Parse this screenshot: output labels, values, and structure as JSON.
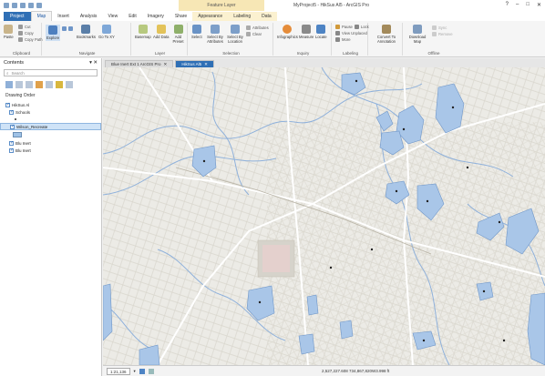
{
  "window": {
    "title": "MyProject5 - HikSus Al5 - ArcGIS Pro",
    "context_title": "Feature Layer"
  },
  "tabs": [
    "Project",
    "Map",
    "Insert",
    "Analysis",
    "View",
    "Edit",
    "Imagery",
    "Share",
    "Appearance",
    "Labeling",
    "Data"
  ],
  "ribbon": {
    "clipboard": {
      "paste": "Paste",
      "cut": "Cut",
      "copy": "Copy",
      "copy_path": "Copy Path",
      "label": "Clipboard"
    },
    "navigate": {
      "explore": "Explore",
      "bookmarks": "Bookmarks",
      "goto": "Go To XY",
      "label": "Navigate"
    },
    "layer": {
      "basemap": "Basemap",
      "add_data": "Add Data",
      "add_preset": "Add Preset",
      "label": "Layer"
    },
    "selection": {
      "select": "Select",
      "by_attributes": "Select By Attributes",
      "by_location": "Select By Location",
      "attributes": "Attributes",
      "clear": "Clear",
      "label": "Selection"
    },
    "inquiry": {
      "infographics": "Infographics",
      "measure": "Measure",
      "locate": "Locate",
      "label": "Inquiry"
    },
    "labeling": {
      "pause": "Pause",
      "lock": "Lock",
      "view_unplaced": "View Unplaced",
      "more": "More",
      "label": "Labeling"
    },
    "convert": {
      "convert": "Convert To Annotation"
    },
    "offline": {
      "download": "Download Map",
      "sync": "Sync",
      "remove": "Remove",
      "label": "Offline"
    }
  },
  "contents": {
    "title": "Contents",
    "search_placeholder": "Search",
    "drawing_order": "Drawing Order",
    "map_name": "HikSus Al",
    "layer_schools": "Schools",
    "layer_wilson": "Wilson_Recreate",
    "layer_blue1": "Blu Inert",
    "layer_blue2": "Blu Inert"
  },
  "map_tabs": [
    "Blue Inert Ext 1 ArcGIS Pro",
    "HikSus Al5"
  ],
  "status": {
    "scale": "1:21,136",
    "coords": "2,527,227.608 734,867,820W3.998 ft"
  },
  "colors": {
    "water": "#a9c6e8",
    "water_stroke": "#6f96c8",
    "road": "#ffffff",
    "road_minor": "#d8d5cc",
    "stream": "#8fb1db",
    "accent": "#2f6fb5"
  }
}
